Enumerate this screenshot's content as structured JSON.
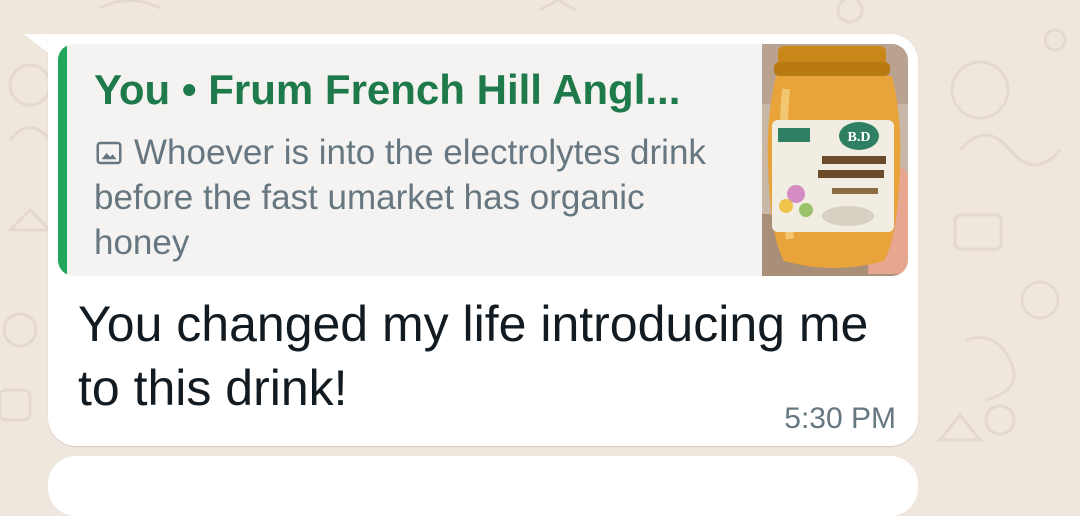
{
  "conversation": {
    "message": {
      "quote": {
        "sender": "You • Frum French Hill Angl...",
        "text": "Whoever is into the electrolytes drink before the fast umarket has organic honey",
        "media_icon": "photo-icon",
        "thumbnail_label": "B.D"
      },
      "text": "You changed my life introducing me to this drink!",
      "time": "5:30 PM"
    }
  },
  "colors": {
    "wallpaper": "#efe7dd",
    "bubble": "#ffffff",
    "quote_accent": "#21a55a",
    "quote_sender": "#1e7a4a",
    "secondary_text": "#667781"
  }
}
